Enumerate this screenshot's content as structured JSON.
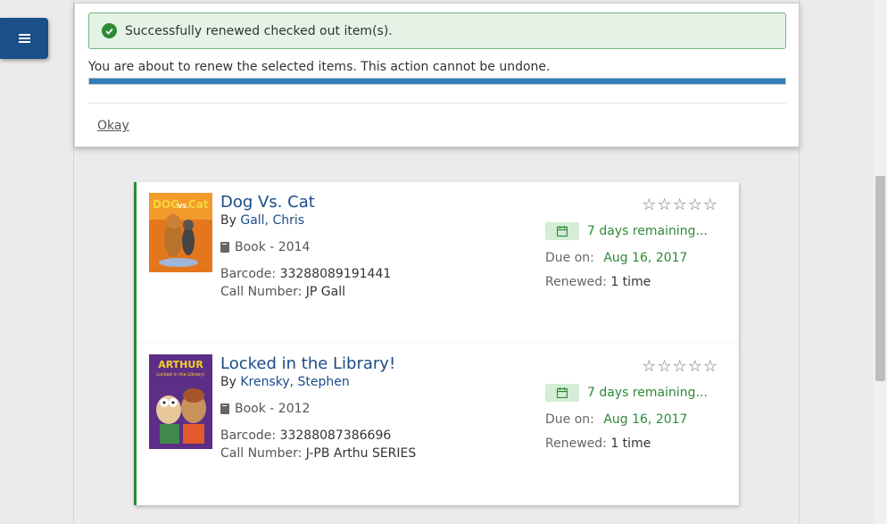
{
  "alert": {
    "text": "Successfully renewed checked out item(s)."
  },
  "modal": {
    "message": "You are about to renew the selected items. This action cannot be undone.",
    "progress": 1.0,
    "okay_label": "Okay"
  },
  "items": [
    {
      "title": "Dog Vs. Cat",
      "by_prefix": "By",
      "author": "Gall, Chris",
      "format": "Book - 2014",
      "barcode_label": "Barcode:",
      "barcode": "33288089191441",
      "call_label": "Call Number:",
      "call_number": "JP Gall",
      "remaining": "7 days remaining...",
      "due_label": "Due on:",
      "due_date": "Aug 16, 2017",
      "renewed_label": "Renewed:",
      "renewed": "1 time"
    },
    {
      "title": "Locked in the Library!",
      "by_prefix": "By",
      "author": "Krensky, Stephen",
      "format": "Book - 2012",
      "barcode_label": "Barcode:",
      "barcode": "33288087386696",
      "call_label": "Call Number:",
      "call_number": "J-PB Arthu SERIES",
      "remaining": "7 days remaining...",
      "due_label": "Due on:",
      "due_date": "Aug 16, 2017",
      "renewed_label": "Renewed:",
      "renewed": "1 time"
    }
  ],
  "cover_art": {
    "dog_vs_cat_word_dog": "DOG",
    "dog_vs_cat_word_vs": "VS.",
    "dog_vs_cat_word_cat": "Cat",
    "arthur_series": "ARTHUR",
    "arthur_subtitle": "Locked in the Library!"
  },
  "colors": {
    "accent_green": "#2d8a36",
    "link_blue": "#1a4c88",
    "menu_blue": "#1b4f8a",
    "progress_blue": "#2e7fb9"
  }
}
